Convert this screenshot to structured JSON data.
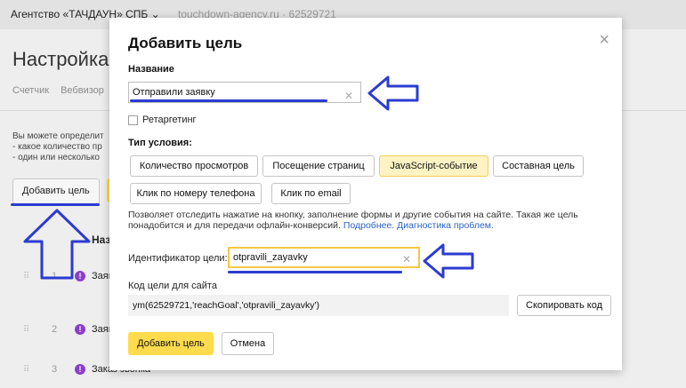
{
  "topbar": {
    "agency": "Агентство «ТАЧДАУН» СПБ ⌄",
    "site": "touchdown-agency.ru · 62529721"
  },
  "background": {
    "title": "Настройка",
    "tabs": [
      "Счетчик",
      "Вебвизор"
    ],
    "description": [
      "Вы можете определит",
      "- какое количество пр",
      "- один или несколько"
    ],
    "add_goal_button": "Добавить цель",
    "column_header": "Назв",
    "rows": [
      {
        "num": "1",
        "name": "Заяв"
      },
      {
        "num": "2",
        "name": "Заяв"
      },
      {
        "num": "3",
        "name": "Заказ звонка"
      }
    ]
  },
  "modal": {
    "title": "Добавить цель",
    "close_glyph": "×",
    "name_label": "Название",
    "name_value": "Отправили заявку",
    "retargeting_label": "Ретаргетинг",
    "condition_type_label": "Тип условия:",
    "condition_buttons": [
      {
        "label": "Количество просмотров",
        "selected": false
      },
      {
        "label": "Посещение страниц",
        "selected": false
      },
      {
        "label": "JavaScript-событие",
        "selected": true
      },
      {
        "label": "Составная цель",
        "selected": false
      },
      {
        "label": "Клик по номеру телефона",
        "selected": false
      },
      {
        "label": "Клик по email",
        "selected": false
      }
    ],
    "description_text": "Позволяет отследить нажатие на кнопку, заполнение формы и другие события на сайте. Такая же цель понадобится и для передачи офлайн-конверсий.",
    "link_more": "Подробнее.",
    "link_diagnostics": "Диагностика проблем.",
    "identifier_label": "Идентификатор цели:",
    "identifier_value": "otpravili_zayavky",
    "code_label": "Код цели для сайта",
    "code_value": "ym(62529721,'reachGoal','otpravili_zayavky')",
    "copy_button": "Скопировать код",
    "submit_button": "Добавить цель",
    "cancel_button": "Отмена"
  },
  "colors": {
    "accent_yellow": "#ffdb4d",
    "selected_bg": "#fff3c4",
    "annotation_blue": "#2b3bd1",
    "link_blue": "#2a62c9"
  }
}
